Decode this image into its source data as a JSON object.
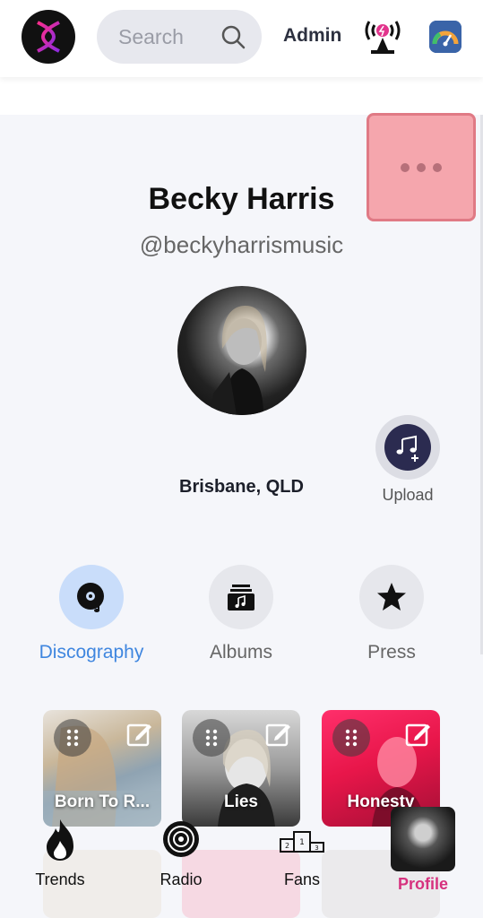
{
  "header": {
    "search_placeholder": "Search",
    "admin_label": "Admin"
  },
  "profile": {
    "name": "Becky Harris",
    "handle": "@beckyharrismusic",
    "location": "Brisbane, QLD",
    "upload_label": "Upload"
  },
  "tabs": [
    {
      "label": "Discography",
      "active": true
    },
    {
      "label": "Albums",
      "active": false
    },
    {
      "label": "Press",
      "active": false
    }
  ],
  "albums": [
    {
      "title": "Born To R..."
    },
    {
      "title": "Lies"
    },
    {
      "title": "Honesty"
    }
  ],
  "bottom_nav": [
    {
      "label": "Trends",
      "icon": "flame-icon"
    },
    {
      "label": "Radio",
      "icon": "radio-icon"
    },
    {
      "label": "Fans",
      "icon": "podium-icon"
    },
    {
      "label": "Profile",
      "icon": "profile-thumb",
      "active": true
    }
  ],
  "colors": {
    "accent_blue": "#3f86df",
    "active_pink": "#d6317e",
    "more_button": "#f5a6ad"
  }
}
